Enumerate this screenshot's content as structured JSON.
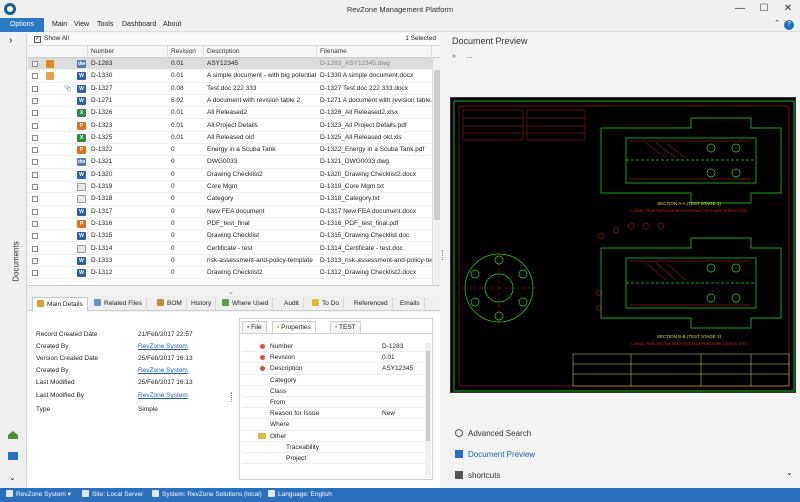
{
  "window": {
    "title": "RevZone Management Platform",
    "min_glyph": "—",
    "max_glyph": "☐",
    "close_glyph": "✕"
  },
  "menu": {
    "options": "Options",
    "items": [
      "Main",
      "View",
      "Tools",
      "Dashboard",
      "About"
    ],
    "help_glyph": "?",
    "collapse_glyph": "⌃"
  },
  "sidebar": {
    "label": "Documents",
    "expand_glyph": "›"
  },
  "grid": {
    "show_all_label": "Show All",
    "selected_count": "1 Selected",
    "columns": [
      "Number",
      "Revision",
      "Description",
      "Filename"
    ],
    "rows": [
      {
        "icon": "dwg",
        "number": "D-1283",
        "revision": "0.01",
        "description": "ASY12345",
        "filename": "D-1283_ASY12345.dwg"
      },
      {
        "icon": "word",
        "number": "D-1330",
        "revision": "0.01",
        "description": "A simple document - with big potential",
        "filename": "D-1330 A simple document.docx"
      },
      {
        "icon": "word",
        "number": "D-1327",
        "revision": "0.08",
        "description": "Test doc 222 333",
        "filename": "D-1327 Test doc 222 333.docx"
      },
      {
        "icon": "word",
        "number": "D-1271",
        "revision": "6.02",
        "description": "A document with revision table 2",
        "filename": "D-1271 A document with revision table."
      },
      {
        "icon": "excel",
        "number": "D-1326",
        "revision": "0.01",
        "description": "All Released2",
        "filename": "D-1326_All Released2.xlsx"
      },
      {
        "icon": "pdf",
        "number": "D-1323",
        "revision": "0.01",
        "description": "All Project Details",
        "filename": "D-1323_All Project Details.pdf"
      },
      {
        "icon": "excel",
        "number": "D-1325",
        "revision": "0.01",
        "description": "All Released old",
        "filename": "D-1325_All Released old.xls"
      },
      {
        "icon": "pdf",
        "number": "D-1322",
        "revision": "0",
        "description": "Energy in a Scuba Tank",
        "filename": "D-1322_Energy in a Scuba Tank.pdf"
      },
      {
        "icon": "dwg",
        "number": "D-1321",
        "revision": "0",
        "description": "DWG0033",
        "filename": "D-1321_DWG0033.dwg"
      },
      {
        "icon": "word",
        "number": "D-1320",
        "revision": "0",
        "description": "Drawing Checklist2",
        "filename": "D-1320_Drawing Checklist2.docx"
      },
      {
        "icon": "txt",
        "number": "D-1319",
        "revision": "0",
        "description": "Core Mgm",
        "filename": "D-1319_Core Mgm.txt"
      },
      {
        "icon": "txt",
        "number": "D-1318",
        "revision": "0",
        "description": "Category",
        "filename": "D-1318_Category.txt"
      },
      {
        "icon": "word",
        "number": "D-1317",
        "revision": "0",
        "description": "New FEA document",
        "filename": "D-1317 New FEA document.docx"
      },
      {
        "icon": "pdf",
        "number": "D-1316",
        "revision": "0",
        "description": "PDF_test_final",
        "filename": "D-1316_PDF_test_final.pdf"
      },
      {
        "icon": "word",
        "number": "D-1315",
        "revision": "0",
        "description": "Drawing Checklist",
        "filename": "D-1315_Drawing Checklist.doc"
      },
      {
        "icon": "txt",
        "number": "D-1314",
        "revision": "0",
        "description": "Certificate - test",
        "filename": "D-1314_Certificate - test.doc"
      },
      {
        "icon": "word",
        "number": "D-1313",
        "revision": "0",
        "description": "risk-assessment-and-policy-template",
        "filename": "D-1313_risk-assessment-and-policy-ten"
      },
      {
        "icon": "word",
        "number": "D-1312",
        "revision": "0",
        "description": "Drawing Checklist2",
        "filename": "D-1312_Drawing Checklist2.docx"
      }
    ]
  },
  "tabs": [
    "Main Details",
    "Related Files",
    "BOM",
    "History",
    "Where Used",
    "Audit",
    "To Do",
    "Referenced",
    "Emails"
  ],
  "details": {
    "fields": [
      {
        "label": "Record Created Date",
        "value": "21/Feb/2017 22:57",
        "link": false
      },
      {
        "label": "Created By",
        "value": "RevZone System",
        "link": true
      },
      {
        "label": "Version Created Date",
        "value": "25/Feb/2017 16:13",
        "link": false
      },
      {
        "label": "Created By",
        "value": "RevZone System",
        "link": true
      },
      {
        "label": "Last Modified",
        "value": "25/Feb/2017 16:13",
        "link": false
      },
      {
        "label": "Last Modified By",
        "value": "RevZone System",
        "link": true
      },
      {
        "label": "Type",
        "value": "Simple",
        "link": false
      }
    ]
  },
  "properties": {
    "tabs": [
      "File",
      "Properties",
      "TEST"
    ],
    "rows": [
      {
        "key": "Number",
        "value": "D-1283",
        "required": true
      },
      {
        "key": "Revision",
        "value": "0.01",
        "required": true
      },
      {
        "key": "Description",
        "value": "ASY12345",
        "required": true
      },
      {
        "key": "Category",
        "value": "",
        "required": false
      },
      {
        "key": "Class",
        "value": "",
        "required": false
      },
      {
        "key": "From",
        "value": "",
        "required": false
      },
      {
        "key": "Reason for Issue",
        "value": "New",
        "required": false
      },
      {
        "key": "Where",
        "value": "",
        "required": false
      },
      {
        "key": "Other",
        "value": "",
        "required": false,
        "group": true
      },
      {
        "key": "Traceability",
        "value": "",
        "required": false
      },
      {
        "key": "Project",
        "value": "",
        "required": false
      }
    ]
  },
  "preview": {
    "title": "Document Preview",
    "toolbar_glyph": "»",
    "toolbar_more": "…",
    "cad_text": {
      "section_a": "SECTION A-A (TEST STAGE 1)",
      "section_a_sub": "C-INSEL PENETRATION BODY EXTERNAL PRESSURE STRESS TEST",
      "section_b": "SECTION B-B (TEST STAGE 2)",
      "section_b_sub": "C-INSEL PENETRATION BODY INTERNAL PRESSURE STRESS TEST"
    }
  },
  "nav": {
    "items": [
      "Advanced Search",
      "Document Preview",
      "shortcuts"
    ]
  },
  "statusbar": {
    "items": [
      "RevZone System ▾",
      "Site: Local Server",
      "System: RevZone Solutions (local)",
      "Language: English"
    ]
  },
  "colors": {
    "accent": "#2b6fbf",
    "menu_active": "#2b78c5",
    "cad_green": "#22e022",
    "cad_red": "#e22020",
    "cad_yellow": "#e0e020"
  }
}
